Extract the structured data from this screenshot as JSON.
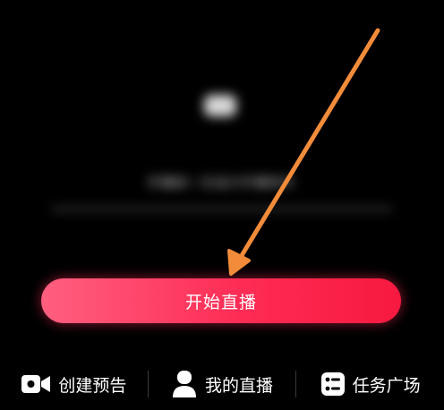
{
  "blurred_content": {
    "caption": "开播前一次设计开播条件"
  },
  "start_button": {
    "label": "开始直播"
  },
  "bottom_bar": {
    "items": [
      {
        "label": "创建预告",
        "icon": "video-camera-icon"
      },
      {
        "label": "我的直播",
        "icon": "user-icon"
      },
      {
        "label": "任务广场",
        "icon": "checklist-icon"
      }
    ]
  },
  "colors": {
    "background": "#000000",
    "button_gradient_start": "#ff5f7f",
    "button_gradient_end": "#f7193f",
    "annotation_arrow": "#f28c3a"
  }
}
